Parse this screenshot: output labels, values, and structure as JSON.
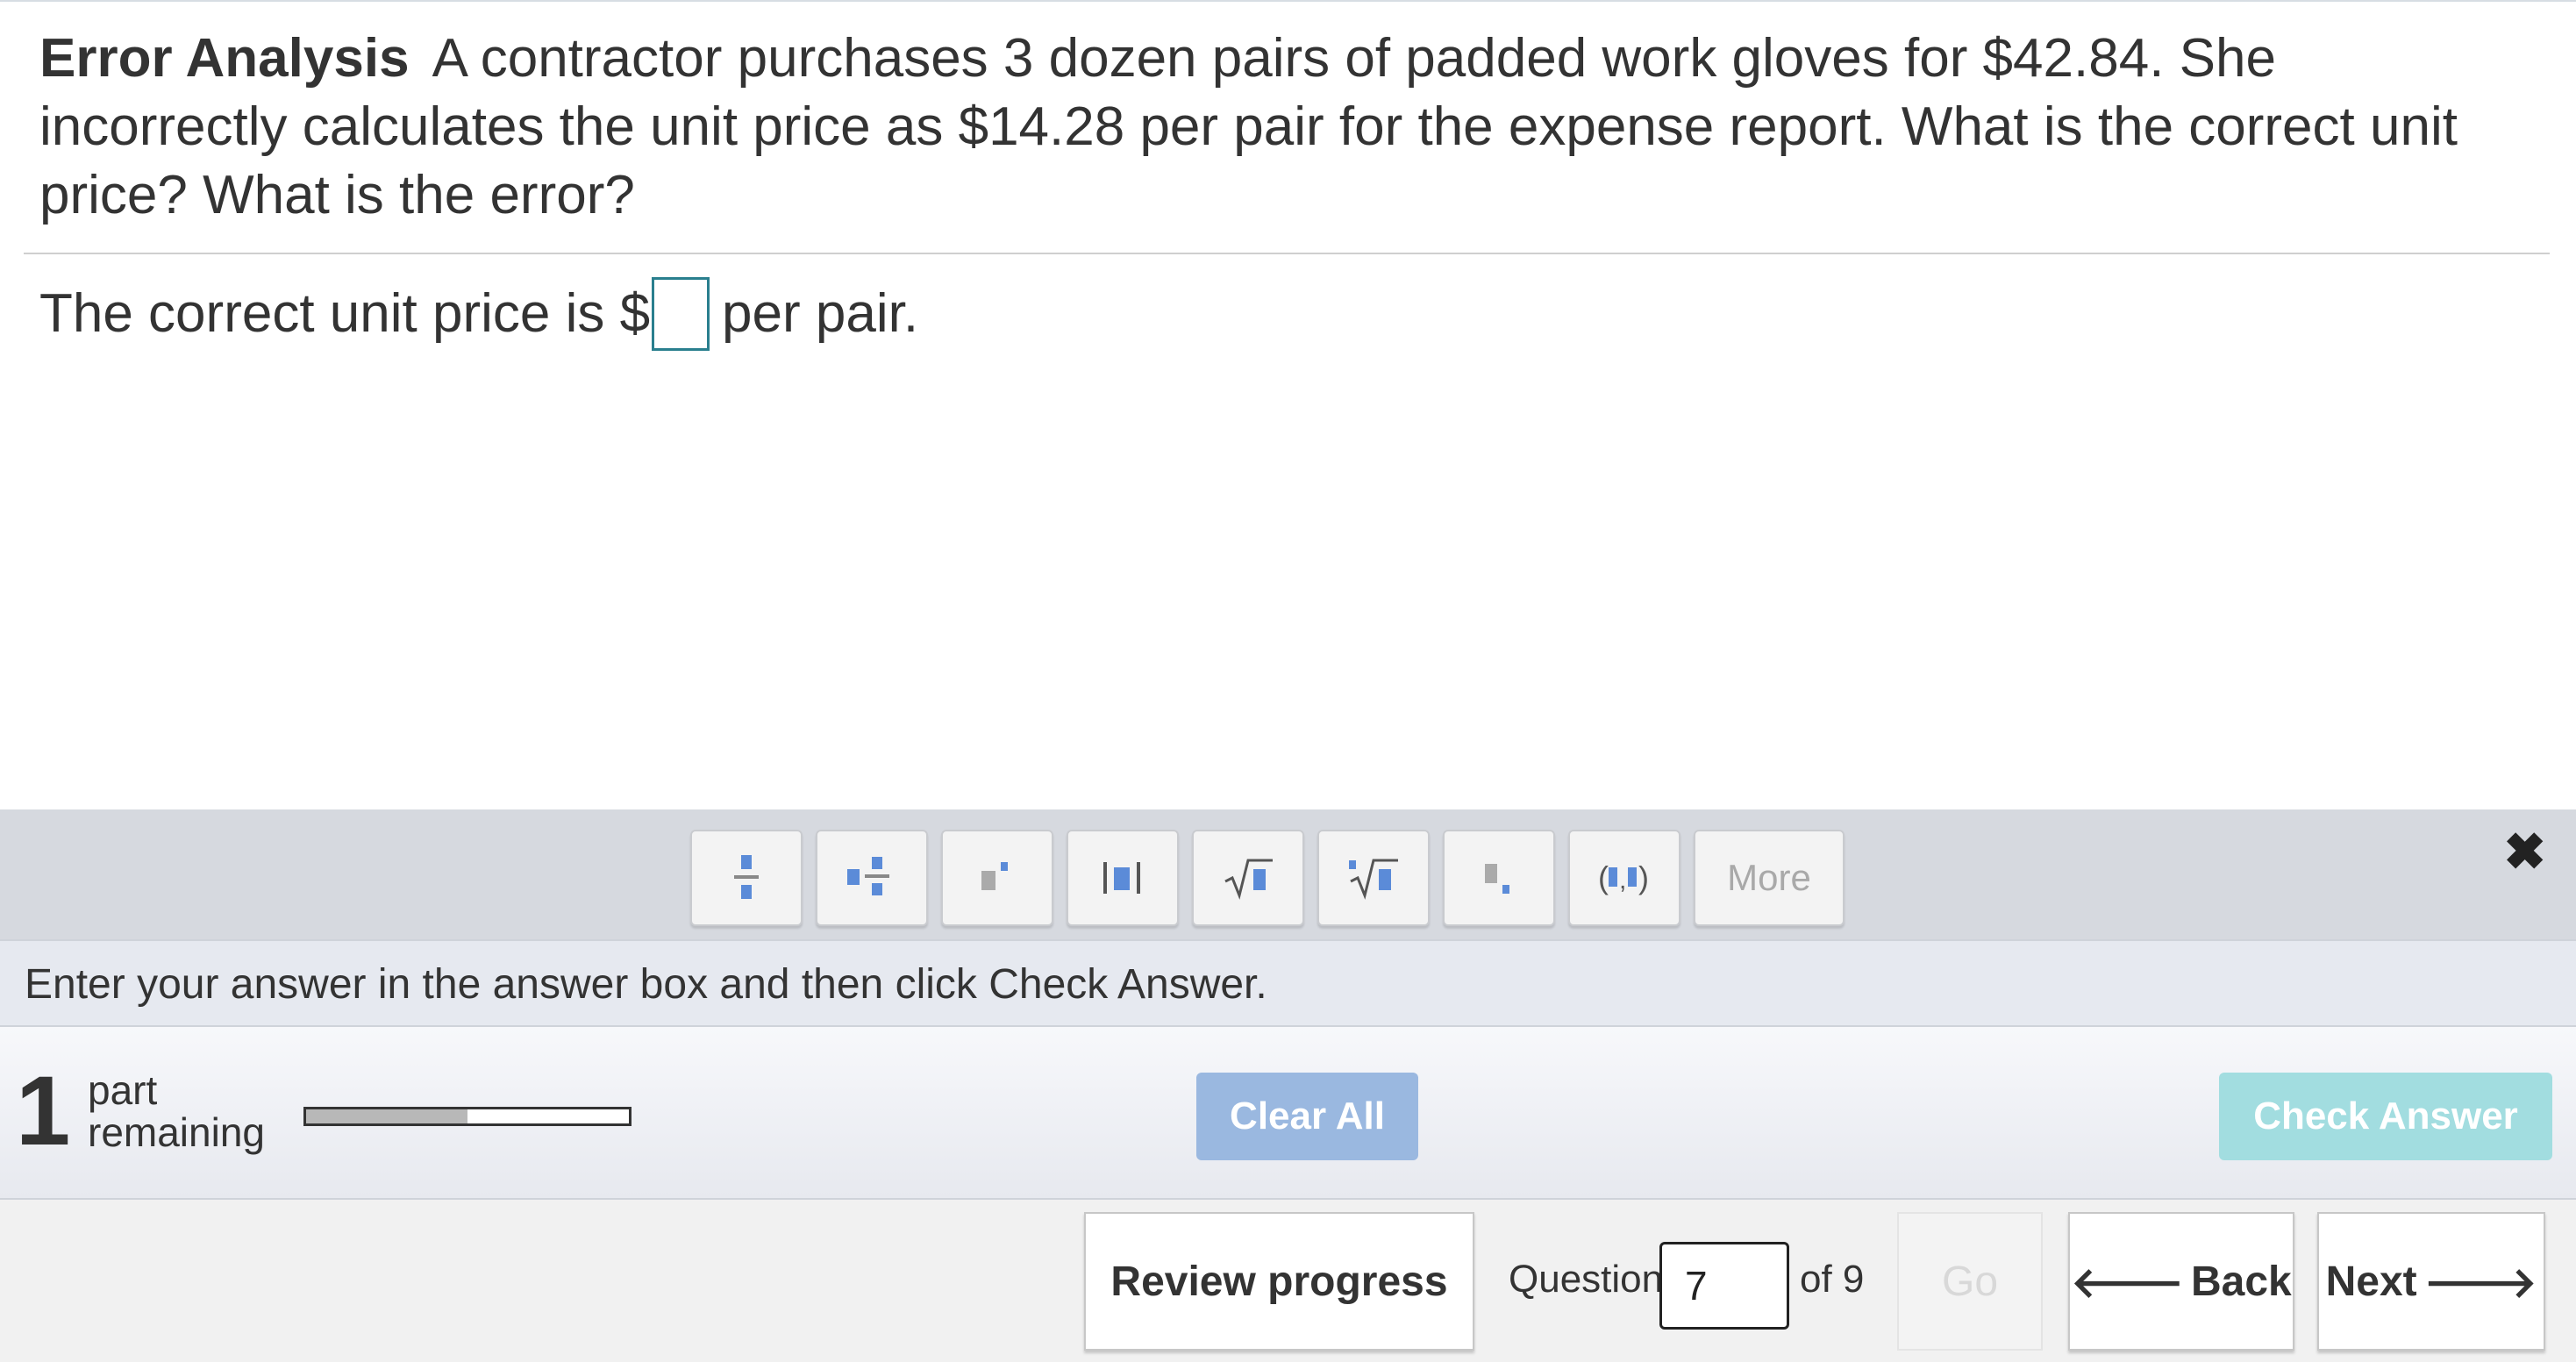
{
  "question": {
    "label": "Error Analysis",
    "text": "A contractor purchases 3 dozen pairs of padded work gloves for $42.84. She incorrectly calculates the unit price as $14.28 per pair for the expense report. What is the correct unit price? What is the error?"
  },
  "answer": {
    "prefix": "The correct unit price is $",
    "value": "",
    "suffix": "per pair."
  },
  "toolbar": {
    "buttons": [
      "fraction",
      "mixed-number",
      "exponent",
      "absolute-value",
      "square-root",
      "nth-root",
      "subscript",
      "ordered-pair"
    ],
    "more_label": "More"
  },
  "instruction": "Enter your answer in the answer box and then click Check Answer.",
  "status": {
    "parts_count": "1",
    "parts_label_1": "part",
    "parts_label_2": "remaining",
    "progress_fraction": 0.5,
    "clear_all_label": "Clear All",
    "check_answer_label": "Check Answer"
  },
  "navigation": {
    "review_label": "Review progress",
    "question_label": "Question",
    "question_number": "7",
    "question_total": "of 9",
    "go_label": "Go",
    "back_label": "Back",
    "next_label": "Next"
  },
  "colors": {
    "answer_box_border": "#2a7f8e",
    "icon_blue": "#5b8bd8",
    "clear_button": "#9ab8e0",
    "check_button": "#a2dde0"
  }
}
